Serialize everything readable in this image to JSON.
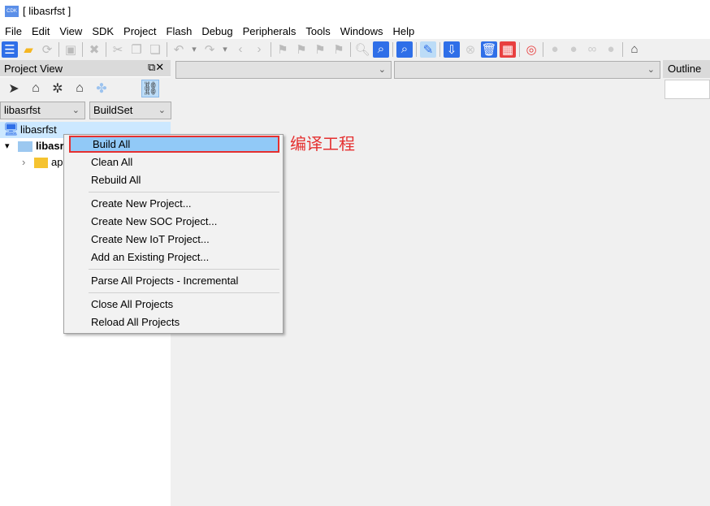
{
  "window": {
    "title": "[ libasrfst ]",
    "logo": "CDK"
  },
  "menu": [
    "File",
    "Edit",
    "View",
    "SDK",
    "Project",
    "Flash",
    "Debug",
    "Peripherals",
    "Tools",
    "Windows",
    "Help"
  ],
  "toolbar": [
    {
      "name": "new-file-icon",
      "g": "☰",
      "c": "#fff",
      "bg": "#2f6fe8"
    },
    {
      "name": "open-folder-icon",
      "g": "▰",
      "c": "#f5b621"
    },
    {
      "name": "refresh-icon",
      "g": "⟳",
      "c": "#bbb"
    },
    {
      "sep": true
    },
    {
      "name": "save-icon",
      "g": "▣",
      "c": "#bbb"
    },
    {
      "sep": true
    },
    {
      "name": "close-icon",
      "g": "✖",
      "c": "#bbb"
    },
    {
      "sep": true
    },
    {
      "name": "cut-icon",
      "g": "✂",
      "c": "#bbb"
    },
    {
      "name": "copy-icon",
      "g": "❐",
      "c": "#bbb"
    },
    {
      "name": "paste-icon",
      "g": "❏",
      "c": "#bbb"
    },
    {
      "sep": true
    },
    {
      "name": "undo-icon",
      "g": "↶",
      "c": "#bbb"
    },
    {
      "name": "undo-dropdown-icon",
      "g": "▾",
      "c": "#888"
    },
    {
      "name": "redo-icon",
      "g": "↷",
      "c": "#bbb"
    },
    {
      "name": "redo-dropdown-icon",
      "g": "▾",
      "c": "#888"
    },
    {
      "name": "back-icon",
      "g": "‹",
      "c": "#bbb"
    },
    {
      "name": "forward-icon",
      "g": "›",
      "c": "#bbb"
    },
    {
      "sep": true
    },
    {
      "name": "bookmark-icon",
      "g": "⚑",
      "c": "#bbb"
    },
    {
      "name": "bookmark-next-icon",
      "g": "⚑",
      "c": "#bbb"
    },
    {
      "name": "bookmark-prev-icon",
      "g": "⚑",
      "c": "#bbb"
    },
    {
      "name": "bookmark-clear-icon",
      "g": "⚑",
      "c": "#bbb"
    },
    {
      "sep": true
    },
    {
      "name": "search-icon",
      "g": "🔍︎",
      "c": "#bbb"
    },
    {
      "name": "find-in-files-icon",
      "g": "⌕",
      "c": "#fff",
      "bg": "#2f6fe8"
    },
    {
      "sep": true
    },
    {
      "name": "find-icon",
      "g": "⌕",
      "c": "#fff",
      "bg": "#2f6fe8"
    },
    {
      "sep": true
    },
    {
      "name": "build-icon",
      "g": "✎",
      "c": "#2f6fe8",
      "bg": "#bcdcf7"
    },
    {
      "sep": true
    },
    {
      "name": "download-icon",
      "g": "⇩",
      "c": "#fff",
      "bg": "#2f6fe8"
    },
    {
      "name": "stop-icon",
      "g": "⊗",
      "c": "#ccc"
    },
    {
      "name": "erase-icon",
      "g": "🗑︎",
      "c": "#fff",
      "bg": "#2f6fe8"
    },
    {
      "name": "load-icon",
      "g": "▦",
      "c": "#fff",
      "bg": "#e84040"
    },
    {
      "sep": true
    },
    {
      "name": "debug-icon",
      "g": "◎",
      "c": "#e84040"
    },
    {
      "sep": true
    },
    {
      "name": "breakpoint-icon",
      "g": "●",
      "c": "#ccc"
    },
    {
      "name": "breakpoints-icon",
      "g": "●",
      "c": "#ccc"
    },
    {
      "name": "link-icon",
      "g": "∞",
      "c": "#ccc"
    },
    {
      "name": "remove-breakpoints-icon",
      "g": "●",
      "c": "#ccc"
    },
    {
      "sep": true
    },
    {
      "name": "home-icon",
      "g": "⌂",
      "c": "#444"
    }
  ],
  "project_view": {
    "title": "Project View",
    "project_combo": "libasrfst",
    "buildset_combo": "BuildSet"
  },
  "tree": {
    "root": "libasrfst",
    "project": "libasr",
    "folder": "ap"
  },
  "outline": {
    "tab": "Outline"
  },
  "context_menu": {
    "items": [
      "Build All",
      "Clean All",
      "Rebuild All",
      "Create New Project...",
      "Create New SOC Project...",
      "Create New IoT Project...",
      "Add an Existing Project...",
      "Parse All Projects - Incremental",
      "Close All Projects",
      "Reload All Projects"
    ]
  },
  "annotation": "编译工程",
  "colors": {
    "highlight": "#91c9f7",
    "annotation": "#e53030",
    "accent": "#2f6fe8"
  }
}
